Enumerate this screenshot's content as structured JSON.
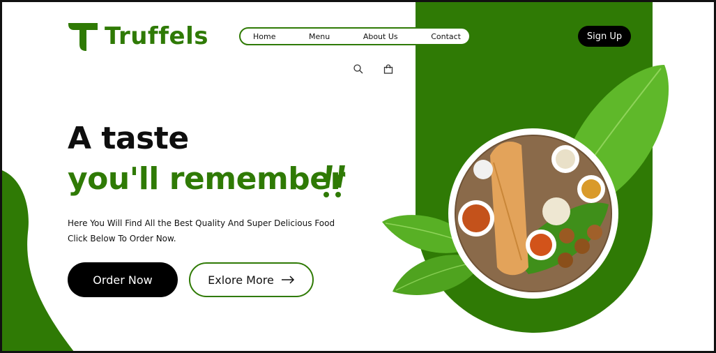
{
  "brand": {
    "name": "Truffels",
    "logo_icon": "t-logo-icon"
  },
  "nav": {
    "items": [
      {
        "label": "Home"
      },
      {
        "label": "Menu"
      },
      {
        "label": "About Us"
      },
      {
        "label": "Contact"
      }
    ]
  },
  "header": {
    "signup_label": "Sign Up",
    "search_icon": "search-icon",
    "cart_icon": "shopping-bag-icon"
  },
  "hero": {
    "headline": "A taste",
    "subheadline": "you'll remember",
    "description_line1": "Here You Will Find All the Best Quality And Super Delicious Food",
    "description_line2": "Click Below To Order Now.",
    "order_button": "Order Now",
    "explore_button": "Exlore More",
    "image_icon": "food-plate-image"
  },
  "colors": {
    "brand_green": "#2f7a05",
    "black": "#000000",
    "white": "#ffffff"
  }
}
